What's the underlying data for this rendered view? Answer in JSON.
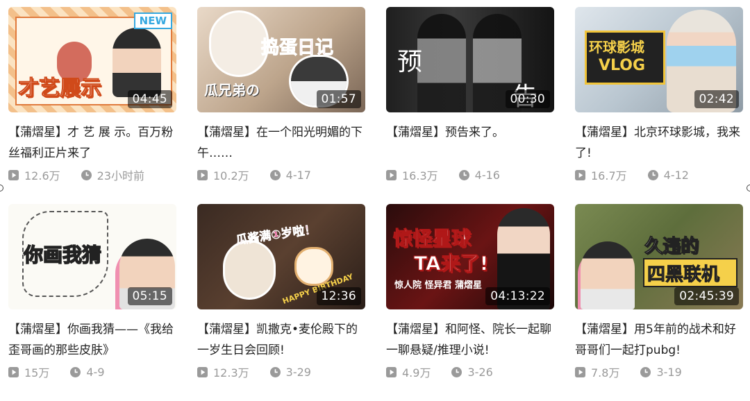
{
  "colors": {
    "accent": "#35a8e0",
    "meta": "#9a9a9a",
    "title": "#222222"
  },
  "icons": {
    "play": "play-count-icon",
    "clock": "date-clock-icon"
  },
  "videos": [
    {
      "title": "【蒲熠星】才 艺 展 示。百万粉丝福利正片来了",
      "duration": "04:45",
      "views": "12.6万",
      "date": "23小时前",
      "thumb": {
        "badge": "NEW",
        "overlay": "才艺展示"
      }
    },
    {
      "title": "【蒲熠星】在一个阳光明媚的下午……",
      "duration": "01:57",
      "views": "10.2万",
      "date": "4-17",
      "thumb": {
        "overlay": "捣蛋日记",
        "overlay2": "瓜兄弟の"
      }
    },
    {
      "title": "【蒲熠星】预告来了。",
      "duration": "00:30",
      "views": "16.3万",
      "date": "4-16",
      "thumb": {
        "overlay": "预",
        "overlay2": "告"
      }
    },
    {
      "title": "【蒲熠星】北京环球影城，我来了!",
      "duration": "02:42",
      "views": "16.7万",
      "date": "4-12",
      "thumb": {
        "overlay": "环球影城",
        "overlay2": "VLOG"
      }
    },
    {
      "title": "【蒲熠星】你画我猜——《我给歪哥画的那些皮肤》",
      "duration": "05:15",
      "views": "15万",
      "date": "4-9",
      "thumb": {
        "overlay": "你画我猜"
      }
    },
    {
      "title": "【蒲熠星】凯撒克•麦伦殿下的一岁生日会回顾!",
      "duration": "12:36",
      "views": "12.3万",
      "date": "3-29",
      "thumb": {
        "overlay": "瓜酱满①岁啦！",
        "overlay2": "HAPPY BIRTHDAY"
      }
    },
    {
      "title": "【蒲熠星】和阿怪、院长一起聊一聊悬疑/推理小说!",
      "duration": "04:13:22",
      "views": "4.9万",
      "date": "3-26",
      "thumb": {
        "overlay": "惊怪星球",
        "overlay2": "TA来了!",
        "overlay3": "惊人院  怪异君  蒲熠星"
      }
    },
    {
      "title": "【蒲熠星】用5年前的战术和好哥哥们一起打pubg!",
      "duration": "02:45:39",
      "views": "7.8万",
      "date": "3-19",
      "thumb": {
        "overlay": "久违的",
        "overlay2": "四黑联机"
      }
    }
  ]
}
